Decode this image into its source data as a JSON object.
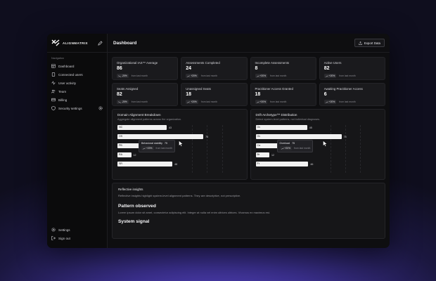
{
  "brand": {
    "name": "ALIGNMATRIX",
    "logo_icon": "logo-icon"
  },
  "sidebar": {
    "section_label": "Navigation",
    "items": [
      {
        "label": "Dashboard",
        "icon": "dashboard-icon"
      },
      {
        "label": "Connected users",
        "icon": "device-icon"
      },
      {
        "label": "User activity",
        "icon": "activity-icon"
      },
      {
        "label": "Team",
        "icon": "team-icon"
      },
      {
        "label": "Billing",
        "icon": "billing-icon"
      },
      {
        "label": "Security settings",
        "icon": "shield-icon"
      }
    ],
    "bottom_items": [
      {
        "label": "Settings",
        "icon": "gear-icon"
      },
      {
        "label": "Sign out",
        "icon": "sign-out-icon"
      }
    ]
  },
  "header": {
    "title": "Dashboard",
    "export_label": "Export Data"
  },
  "stats_row1": [
    {
      "label": "Organizational IAS™ Average",
      "value": "86",
      "change": "-20%",
      "note": "from last month"
    },
    {
      "label": "Assessments Completed",
      "value": "24",
      "change": "+20%",
      "note": "from last month"
    },
    {
      "label": "Incomplete Assessments",
      "value": "8",
      "change": "+20%",
      "note": "from last month"
    },
    {
      "label": "Active Users",
      "value": "82",
      "change": "+20%",
      "note": "from last month"
    }
  ],
  "stats_row2": [
    {
      "label": "Seats Assigned",
      "value": "82",
      "change": "-20%",
      "note": "from last month"
    },
    {
      "label": "Unassigned Seats",
      "value": "18",
      "change": "+20%",
      "note": "from last month"
    },
    {
      "label": "Practitioner Access Granted",
      "value": "18",
      "change": "+20%",
      "note": "from last month"
    },
    {
      "label": "Awaiting Practitioner Access",
      "value": "6",
      "change": "+20%",
      "note": "from last month"
    }
  ],
  "domain_panel": {
    "title": "Domain Alignment Breakdown",
    "subtitle": "Aggregate alignment patterns across the organization.",
    "bars": [
      {
        "label": "NC",
        "value": 43
      },
      {
        "label": "OS",
        "value": 75
      },
      {
        "label": "PB",
        "value": 30
      },
      {
        "label": "RA",
        "value": 12
      },
      {
        "label": "SR",
        "value": 48
      }
    ],
    "tooltip": {
      "label": "Behavioral stability",
      "value": "75",
      "change": "+20%",
      "note": "from last month"
    }
  },
  "drift_panel": {
    "title": "Drift Archetype™ Distribution",
    "subtitle": "Detect system-level patterns, not individual diagnoses.",
    "bars": [
      {
        "label": "Ov",
        "value": 45
      },
      {
        "label": "Ov",
        "value": 75
      },
      {
        "label": "Ca",
        "value": 30
      },
      {
        "label": "Br",
        "value": 12
      },
      {
        "label": "Fr",
        "value": 46
      }
    ],
    "tooltip": {
      "label": "Overload",
      "value": "75",
      "change": "+20%",
      "note": "from last month"
    }
  },
  "insights": {
    "title": "Reflective insights",
    "description": "Reflective insights highlight system-level alignment patterns. They are descriptive, not prescriptive.",
    "section1_heading": "Pattern observed",
    "section1_text": "Lorem ipsum dolor sit amet, consectetur adipiscing elit. Integer at nulla vel enim ultrices ultrices. Vivamus ex maximus est.",
    "section2_heading": "System signal"
  },
  "chart_data": [
    {
      "type": "bar",
      "title": "Domain Alignment Breakdown",
      "categories": [
        "NC",
        "OS",
        "PB",
        "RA",
        "SR"
      ],
      "values": [
        43,
        75,
        30,
        12,
        48
      ],
      "xlim": [
        0,
        100
      ]
    },
    {
      "type": "bar",
      "title": "Drift Archetype™ Distribution",
      "categories": [
        "Ov",
        "Ov",
        "Ca",
        "Br",
        "Fr"
      ],
      "values": [
        45,
        75,
        30,
        12,
        46
      ],
      "xlim": [
        0,
        100
      ]
    }
  ]
}
